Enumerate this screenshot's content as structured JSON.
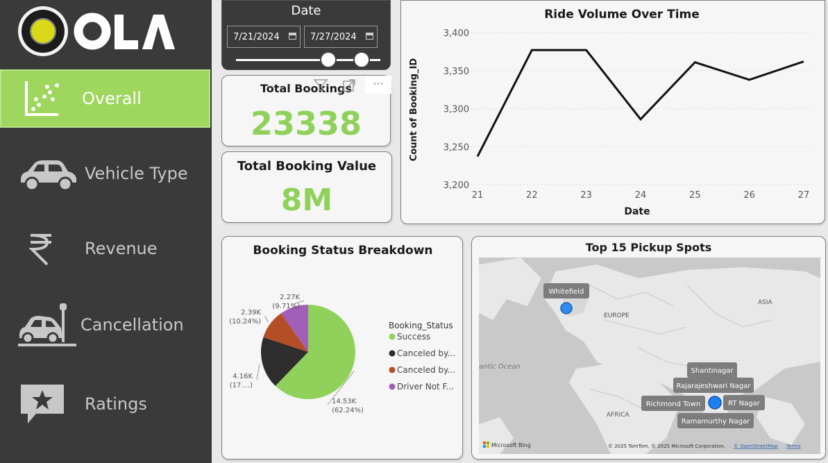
{
  "brand": {
    "name": "OLA"
  },
  "sidebar": {
    "items": [
      {
        "label": "Overall",
        "icon": "scatter-chart-icon",
        "active": true
      },
      {
        "label": "Vehicle Type",
        "icon": "car-icon",
        "active": false
      },
      {
        "label": "Revenue",
        "icon": "rupee-icon",
        "active": false
      },
      {
        "label": "Cancellation",
        "icon": "car-crash-icon",
        "active": false
      },
      {
        "label": "Ratings",
        "icon": "star-comment-icon",
        "active": false
      }
    ]
  },
  "date_slicer": {
    "title": "Date",
    "start": "7/21/2024",
    "end": "7/27/2024",
    "range_fraction": [
      0.64,
      0.87
    ]
  },
  "kpis": {
    "total_bookings": {
      "label": "Total Bookings",
      "value": "23338"
    },
    "total_booking_value": {
      "label": "Total Booking Value",
      "value": "8M"
    }
  },
  "visual_header": {
    "icons": [
      "filter-icon",
      "focus-mode-icon",
      "more-options-icon"
    ],
    "more_label": "···"
  },
  "colors": {
    "accent": "#8fd15a",
    "sidebar": "#3a3a3a",
    "success": "#8fd15a",
    "canceled_customer": "#2d2d2d",
    "canceled_driver": "#b34e27",
    "driver_not_found": "#a25fb8"
  },
  "chart_data": [
    {
      "type": "line",
      "title": "Ride Volume Over Time",
      "xlabel": "Date",
      "ylabel": "Count of Booking_ID",
      "x": [
        21,
        22,
        23,
        24,
        25,
        26,
        27
      ],
      "series": [
        {
          "values": [
            3237,
            3377,
            3377,
            3286,
            3361,
            3338,
            3362
          ]
        }
      ],
      "ylim": [
        3200,
        3400
      ],
      "yticks": [
        "3,200",
        "3,250",
        "3,300",
        "3,350",
        "3,400"
      ],
      "grid": true
    },
    {
      "type": "pie",
      "title": "Booking Status Breakdown",
      "legend_title": "Booking_Status",
      "legend_position": "right",
      "slices": [
        {
          "legend": "Success",
          "value": 14530,
          "label": "14.53K",
          "pct_label": "(62.24%)"
        },
        {
          "legend": "Canceled by...",
          "value": 4160,
          "label": "4.16K",
          "pct_label": "(17....)"
        },
        {
          "legend": "Canceled by...",
          "value": 2390,
          "label": "2.39K",
          "pct_label": "(10.24%)"
        },
        {
          "legend": "Driver Not F...",
          "value": 2270,
          "label": "2.27K",
          "pct_label": "(9.71%)"
        }
      ]
    }
  ],
  "map": {
    "title": "Top 15 Pickup Spots",
    "region_labels": [
      "EUROPE",
      "ASIA",
      "AFRICA",
      "antic Ocean"
    ],
    "pins": [
      "Whitefield",
      "Shantinagar",
      "Rajarajeshwari Nagar",
      "Richmond Town",
      "RT Nagar",
      "Ramamurthy Nagar"
    ],
    "attribution": "© 2025 TomTom, © 2025 Microsoft Corporation,",
    "osm_link": "© OpenStreetMap",
    "terms": "Terms",
    "bing": "Microsoft Bing"
  }
}
